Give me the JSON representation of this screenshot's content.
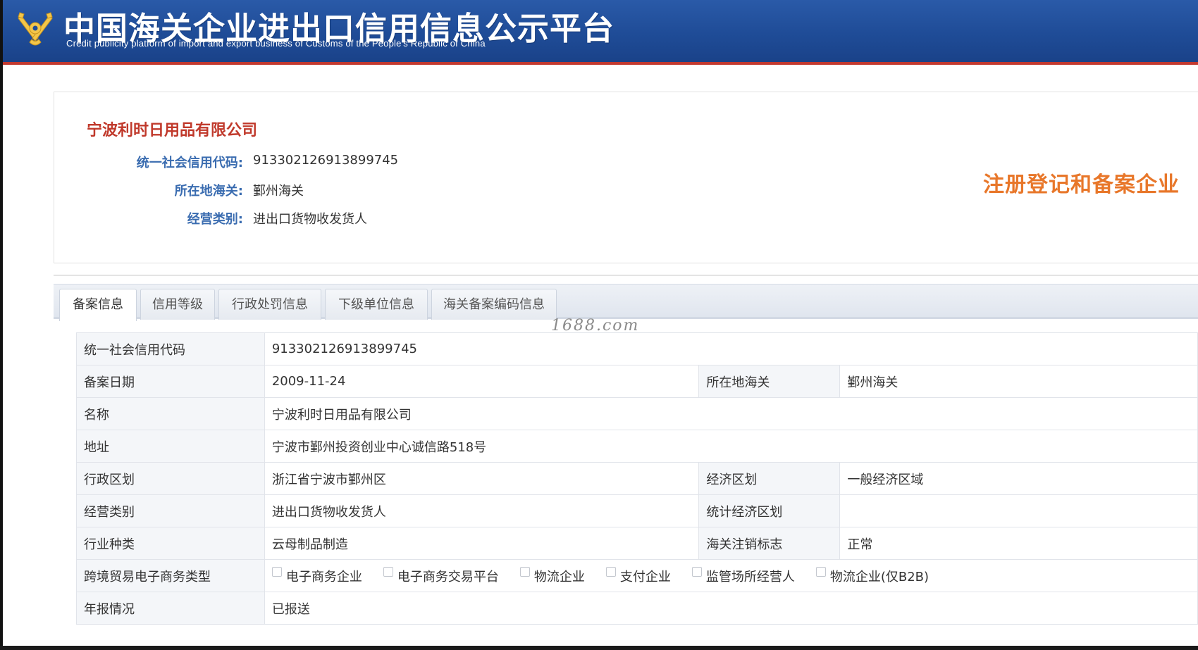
{
  "header": {
    "title": "中国海关企业进出口信用信息公示平台",
    "subtitle": "Credit publicity platform of import and export business of Customs of the People's Republic of China",
    "emblem_icon": "customs-emblem-icon",
    "colors": {
      "bar": "#1f4c97",
      "accent_line": "#c2392f"
    }
  },
  "company": {
    "name": "宁波利时日用品有限公司",
    "fields": [
      {
        "label": "统一社会信用代码:",
        "value": "913302126913899745"
      },
      {
        "label": "所在地海关:",
        "value": "鄞州海关"
      },
      {
        "label": "经营类别:",
        "value": "进出口货物收发货人"
      }
    ],
    "badge": "注册登记和备案企业"
  },
  "tabs": [
    {
      "label": "备案信息",
      "active": true
    },
    {
      "label": "信用等级",
      "active": false
    },
    {
      "label": "行政处罚信息",
      "active": false
    },
    {
      "label": "下级单位信息",
      "active": false
    },
    {
      "label": "海关备案编码信息",
      "active": false
    }
  ],
  "watermark": "1688.com",
  "details": {
    "credit_code": {
      "label": "统一社会信用代码",
      "value": "913302126913899745"
    },
    "record_date": {
      "label": "备案日期",
      "value": "2009-11-24"
    },
    "customs": {
      "label": "所在地海关",
      "value": "鄞州海关"
    },
    "name": {
      "label": "名称",
      "value": "宁波利时日用品有限公司"
    },
    "address": {
      "label": "地址",
      "value": "宁波市鄞州投资创业中心诚信路518号"
    },
    "admin_region": {
      "label": "行政区划",
      "value": "浙江省宁波市鄞州区"
    },
    "econ_region": {
      "label": "经济区划",
      "value": "一般经济区域"
    },
    "business_type": {
      "label": "经营类别",
      "value": "进出口货物收发货人"
    },
    "stat_region": {
      "label": "统计经济区划",
      "value": ""
    },
    "industry": {
      "label": "行业种类",
      "value": "云母制品制造"
    },
    "cancel_flag": {
      "label": "海关注销标志",
      "value": "正常"
    },
    "ecommerce": {
      "label": "跨境贸易电子商务类型",
      "options": [
        {
          "label": "电子商务企业",
          "checked": false
        },
        {
          "label": "电子商务交易平台",
          "checked": false
        },
        {
          "label": "物流企业",
          "checked": false
        },
        {
          "label": "支付企业",
          "checked": false
        },
        {
          "label": "监管场所经营人",
          "checked": false
        },
        {
          "label": "物流企业(仅B2B)",
          "checked": false
        }
      ]
    },
    "annual_report": {
      "label": "年报情况",
      "value": "已报送"
    }
  }
}
